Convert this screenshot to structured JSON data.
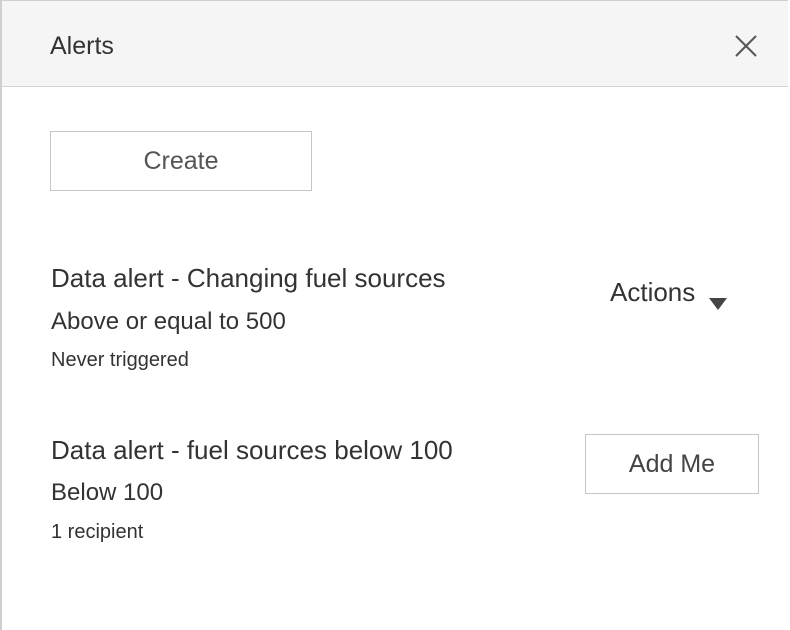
{
  "header": {
    "title": "Alerts",
    "close_icon": "close-icon"
  },
  "toolbar": {
    "create_label": "Create"
  },
  "alerts": [
    {
      "title": "Data alert - Changing fuel sources",
      "condition": "Above or equal to 500",
      "meta": "Never triggered",
      "action_label": "Actions",
      "action_icon": "caret-down-icon"
    },
    {
      "title": "Data alert - fuel sources below 100",
      "condition": "Below 100",
      "meta": "1 recipient",
      "action_label": "Add Me"
    }
  ],
  "colors": {
    "header_background": "#f5f5f5",
    "text": "#333333",
    "button_border": "#c6c6c6"
  }
}
